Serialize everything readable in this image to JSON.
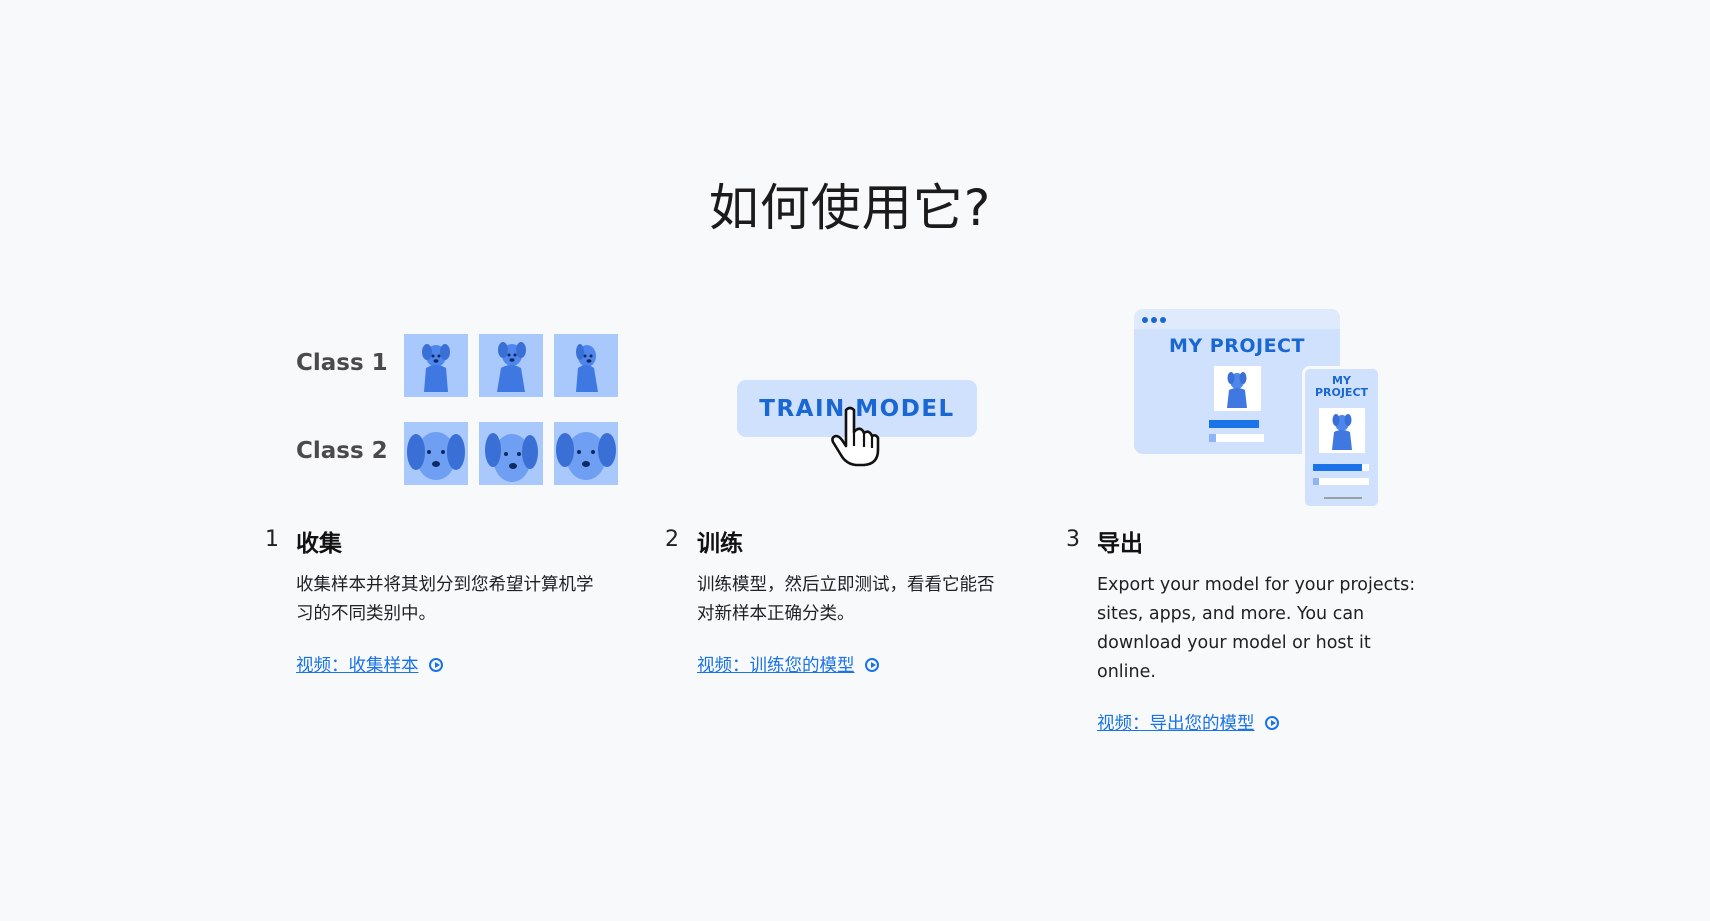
{
  "page": {
    "title": "如何使用它?"
  },
  "illustrations": {
    "collect": {
      "class_1_label": "Class 1",
      "class_2_label": "Class 2"
    },
    "train": {
      "button_label": "TRAIN MODEL"
    },
    "export": {
      "browser_title": "MY PROJECT",
      "phone_title_line1": "MY",
      "phone_title_line2": "PROJECT"
    }
  },
  "steps": [
    {
      "number": "1",
      "title": "收集",
      "description_line1": "收集样本并将其划分到您希望计算机学",
      "description_line2": "习的不同类别中。",
      "link": "视频：收集样本"
    },
    {
      "number": "2",
      "title": "训练",
      "description_line1": "训练模型，然后立即测试，看看它能否",
      "description_line2": "对新样本正确分类。",
      "link": "视频：训练您的模型"
    },
    {
      "number": "3",
      "title": "导出",
      "description_line1": "Export your model for your projects:",
      "description_line2": "sites, apps, and more. You can",
      "description_line3": "download your model or host it",
      "description_line4": "online.",
      "link": "视频：导出您的模型"
    }
  ],
  "colors": {
    "accent": "#1a73e8",
    "tile": "#a9c8fb",
    "panel": "#cfe1fd",
    "background": "#f8f9fb"
  }
}
